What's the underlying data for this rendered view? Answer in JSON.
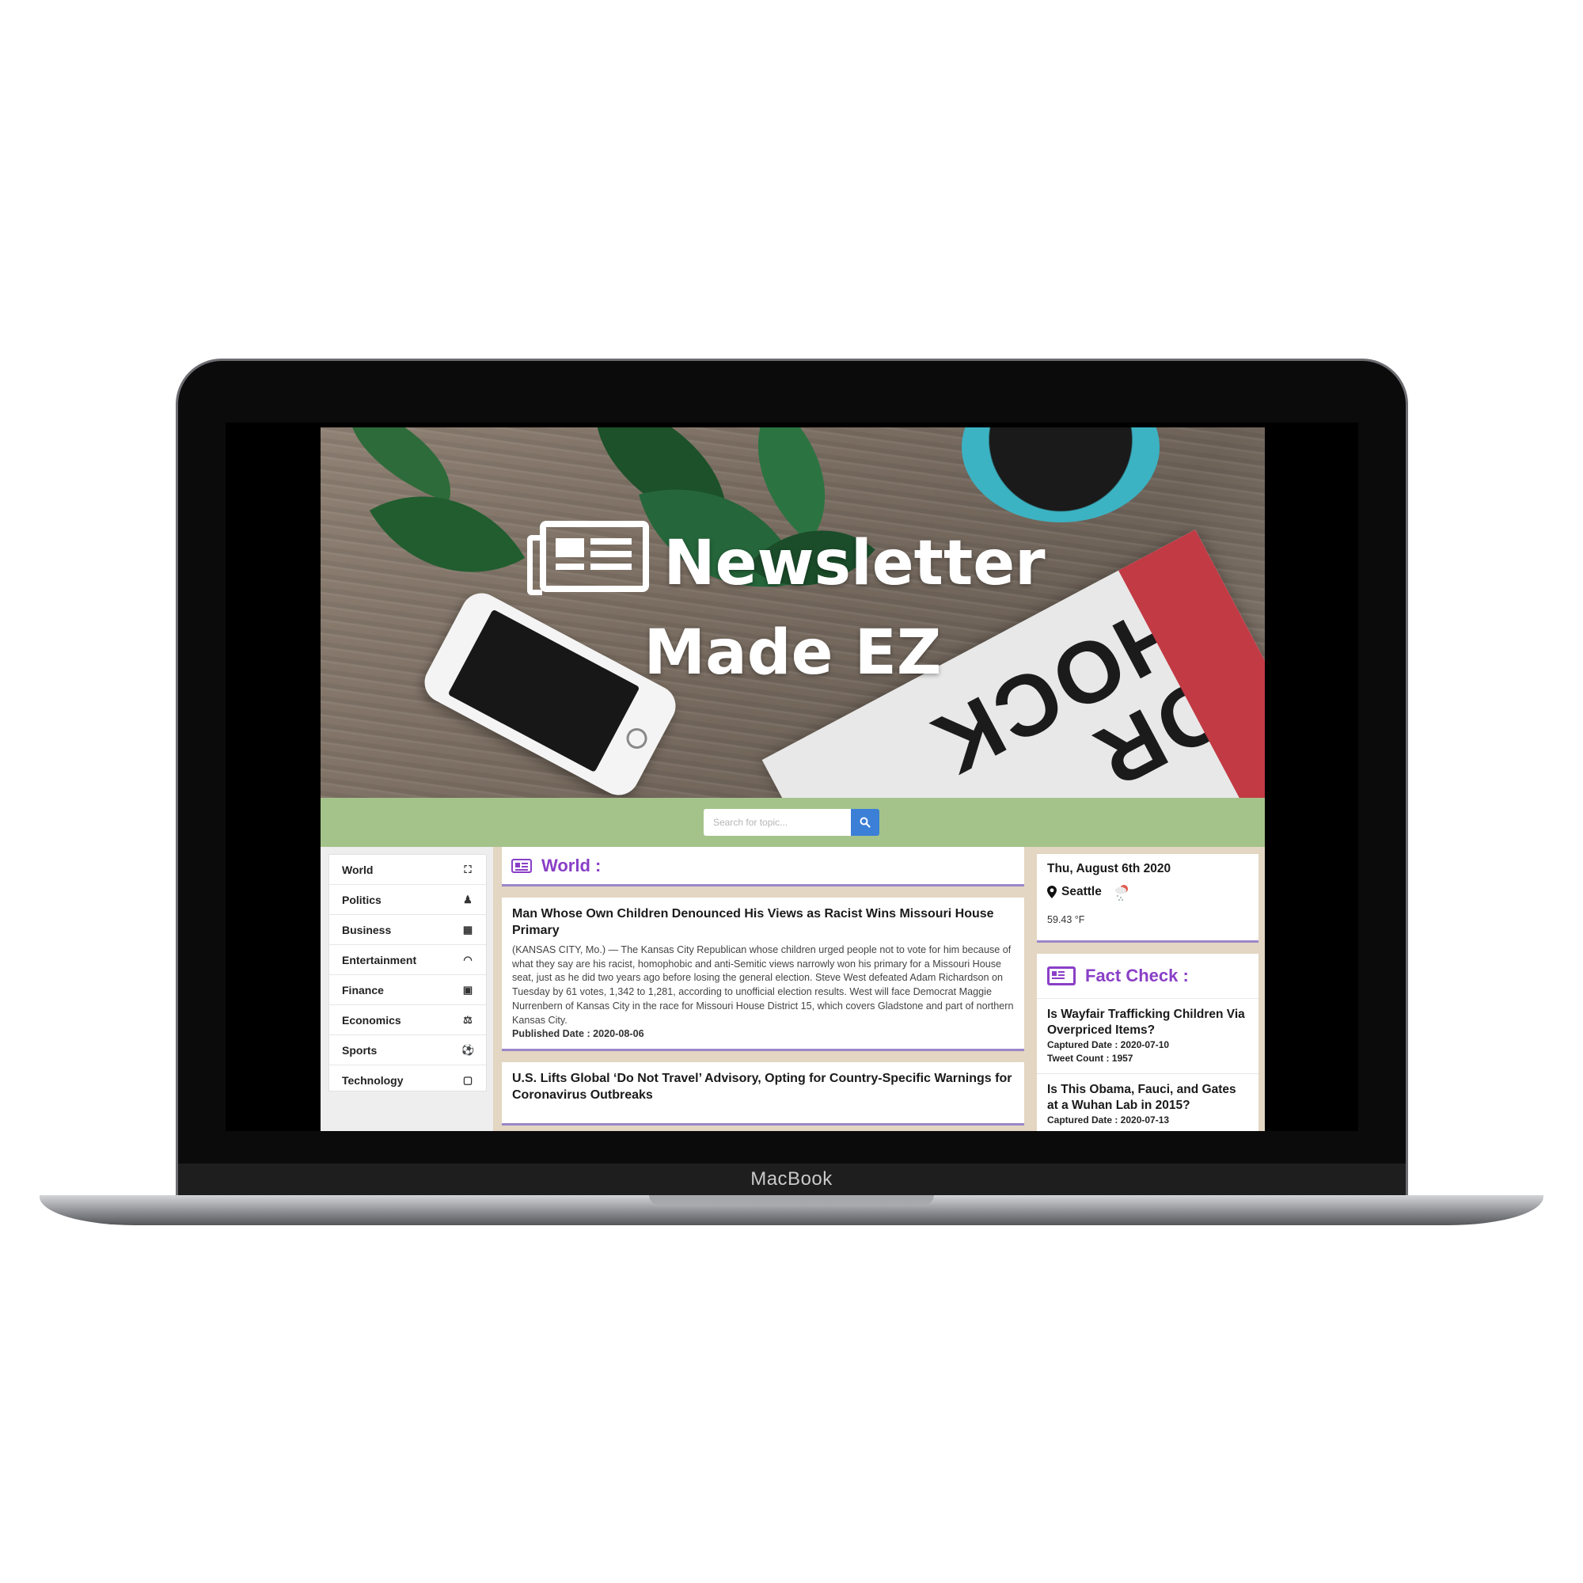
{
  "device": {
    "brand": "MacBook"
  },
  "hero": {
    "title_line1": "Newsletter",
    "title_line2": "Made EZ",
    "newspaper_text": "FOR SHOCK"
  },
  "search": {
    "placeholder": "Search for topic...",
    "button_icon": "search-icon"
  },
  "sidebar": {
    "items": [
      {
        "label": "World",
        "icon": "binoculars-icon",
        "glyph": "⛶"
      },
      {
        "label": "Politics",
        "icon": "chess-icon",
        "glyph": "♟"
      },
      {
        "label": "Business",
        "icon": "building-icon",
        "glyph": "▦"
      },
      {
        "label": "Entertainment",
        "icon": "headphones-icon",
        "glyph": "◠"
      },
      {
        "label": "Finance",
        "icon": "money-bill-icon",
        "glyph": "▣"
      },
      {
        "label": "Economics",
        "icon": "balance-scale-icon",
        "glyph": "⚖"
      },
      {
        "label": "Sports",
        "icon": "football-icon",
        "glyph": "⚽"
      },
      {
        "label": "Technology",
        "icon": "tablet-icon",
        "glyph": "▢"
      }
    ]
  },
  "main": {
    "section_title": "World :",
    "articles": [
      {
        "title": "Man Whose Own Children Denounced His Views as Racist Wins Missouri House Primary",
        "body": "(KANSAS CITY, Mo.) — The Kansas City Republican whose children urged people not to vote for him because of what they say are his racist, homophobic and anti-Semitic views narrowly won his primary for a Missouri House seat, just as he did two years ago before losing the general election. Steve West defeated Adam Richardson on Tuesday by 61 votes, 1,342 to 1,281, according to unofficial election results. West will face Democrat Maggie Nurrenbern of Kansas City in the race for Missouri House District 15, which covers Gladstone and part of northern Kansas City.",
        "published": "Published Date : 2020-08-06"
      },
      {
        "title": "U.S. Lifts Global ‘Do Not Travel’ Advisory, Opting for Country-Specific Warnings for Coronavirus Outbreaks"
      }
    ]
  },
  "weather": {
    "date": "Thu, August 6th 2020",
    "city": "Seattle",
    "icon": "rain-cloud-icon",
    "temp": "59.43 °F"
  },
  "fact_check": {
    "title": "Fact Check :",
    "items": [
      {
        "title": "Is Wayfair Trafficking Children Via Overpriced Items?",
        "captured": "Captured Date : 2020-07-10",
        "tweets": "Tweet Count : 1957"
      },
      {
        "title": "Is This Obama, Fauci, and Gates at a Wuhan Lab in 2015?",
        "captured": "Captured Date : 2020-07-13"
      }
    ]
  },
  "colors": {
    "accent_purple": "#8a3fc7",
    "search_bar_green": "#a4c38b",
    "search_button_blue": "#3b7fd6",
    "content_bg": "#e3d6c2"
  }
}
